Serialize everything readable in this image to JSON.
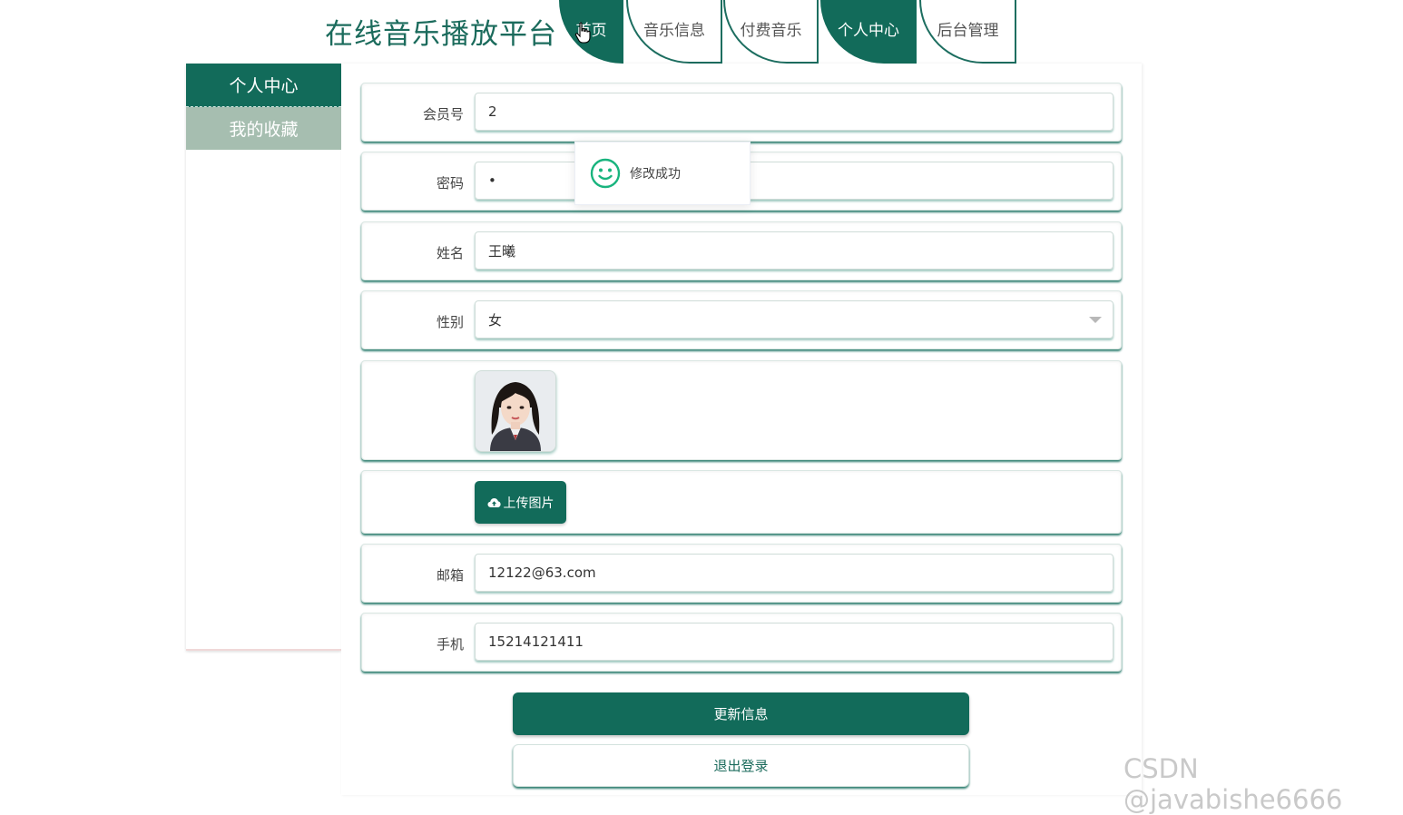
{
  "header": {
    "site_title": "在线音乐播放平台",
    "nav": [
      {
        "label": "首页",
        "active": true
      },
      {
        "label": "音乐信息",
        "active": false
      },
      {
        "label": "付费音乐",
        "active": false
      },
      {
        "label": "个人中心",
        "active": true
      },
      {
        "label": "后台管理",
        "active": false
      }
    ]
  },
  "sidebar": {
    "items": [
      {
        "label": "个人中心",
        "active": true
      },
      {
        "label": "我的收藏",
        "active": false
      }
    ]
  },
  "form": {
    "member_no": {
      "label": "会员号",
      "value": "2"
    },
    "password": {
      "label": "密码",
      "value": "•"
    },
    "name": {
      "label": "姓名",
      "value": "王曦"
    },
    "gender": {
      "label": "性别",
      "value": "女"
    },
    "upload_label": "上传图片",
    "email": {
      "label": "邮箱",
      "value": "12122@63.com"
    },
    "phone": {
      "label": "手机",
      "value": "15214121411"
    }
  },
  "toast": {
    "message": "修改成功"
  },
  "actions": {
    "update_label": "更新信息",
    "logout_label": "退出登录"
  },
  "watermark": "CSDN @javabishe6666",
  "colors": {
    "primary": "#126b5a",
    "sidebar_inactive": "#a6beb0",
    "accent_text": "#1b6b5c"
  }
}
